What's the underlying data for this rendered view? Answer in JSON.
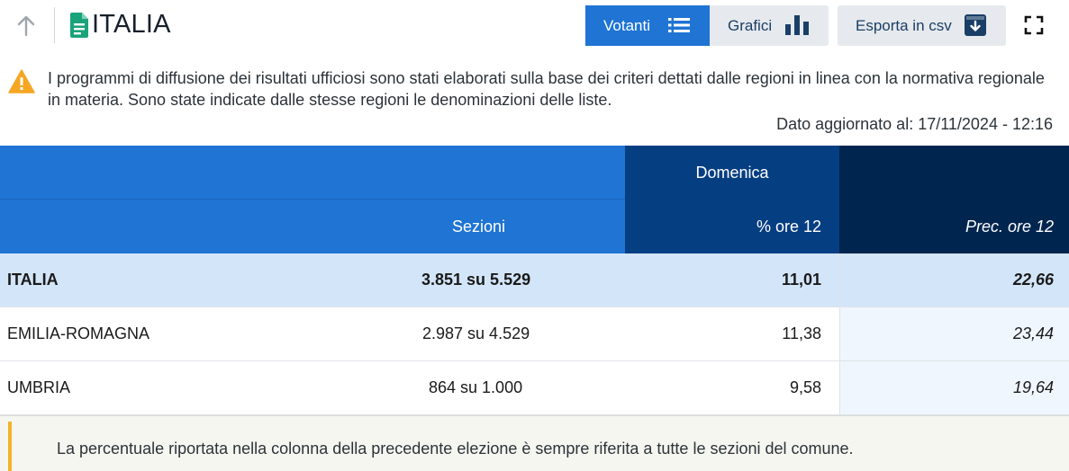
{
  "header": {
    "title": "ITALIA",
    "buttons": {
      "votanti": "Votanti",
      "grafici": "Grafici",
      "csv": "Esporta in csv"
    },
    "icons": [
      "arrow-up-icon",
      "document-icon",
      "list-icon",
      "bar-chart-icon",
      "download-icon",
      "fullscreen-icon"
    ]
  },
  "warning": {
    "text": "I programmi di diffusione dei risultati ufficiosi sono stati elaborati sulla base dei criteri dettati dalle regioni in linea con la normativa regionale in materia. Sono state indicate dalle stesse regioni le denominazioni delle liste.",
    "updated": "Dato aggiornato al: 17/11/2024 - 12:16"
  },
  "table": {
    "group_header": "Domenica",
    "columns": {
      "sezioni": "Sezioni",
      "pct": "% ore 12",
      "prec": "Prec. ore 12"
    },
    "rows": [
      {
        "name": "ITALIA",
        "sezioni": "3.851 su 5.529",
        "pct": "11,01",
        "prec": "22,66"
      },
      {
        "name": "EMILIA-ROMAGNA",
        "sezioni": "2.987 su 4.529",
        "pct": "11,38",
        "prec": "23,44"
      },
      {
        "name": "UMBRIA",
        "sezioni": "864 su 1.000",
        "pct": "9,58",
        "prec": "19,64"
      }
    ]
  },
  "note": {
    "text": "La percentuale riportata nella colonna della precedente elezione è sempre riferita a tutte le sezioni del comune."
  },
  "colors": {
    "primary": "#1f74d4",
    "dark_blue": "#063e82",
    "navy": "#00254f",
    "total_row": "#d3e5f9",
    "warning": "#f5a623",
    "doc_icon": "#1aa37a",
    "note_bar": "#f0b429"
  }
}
